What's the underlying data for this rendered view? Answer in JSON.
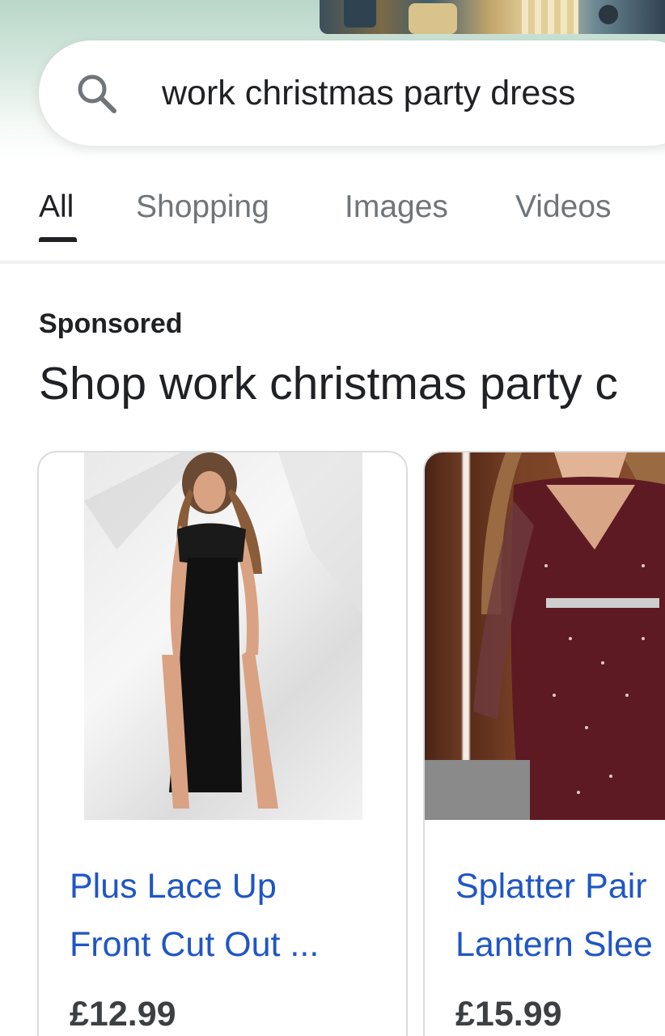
{
  "search": {
    "query": "work christmas party dress"
  },
  "tabs": [
    {
      "label": "All",
      "active": true
    },
    {
      "label": "Shopping",
      "active": false
    },
    {
      "label": "Images",
      "active": false
    },
    {
      "label": "Videos",
      "active": false
    }
  ],
  "ads": {
    "sponsored_label": "Sponsored",
    "heading": "Shop work christmas party c"
  },
  "products": [
    {
      "title_line1": "Plus Lace Up",
      "title_line2": "Front Cut Out ...",
      "price": "£12.99"
    },
    {
      "title_line1": "Splatter Pair",
      "title_line2": "Lantern Slee",
      "price": "£15.99"
    }
  ],
  "colors": {
    "link": "#1f56c5",
    "text": "#202124",
    "tab_inactive": "#70757a",
    "price": "#3c4043"
  }
}
